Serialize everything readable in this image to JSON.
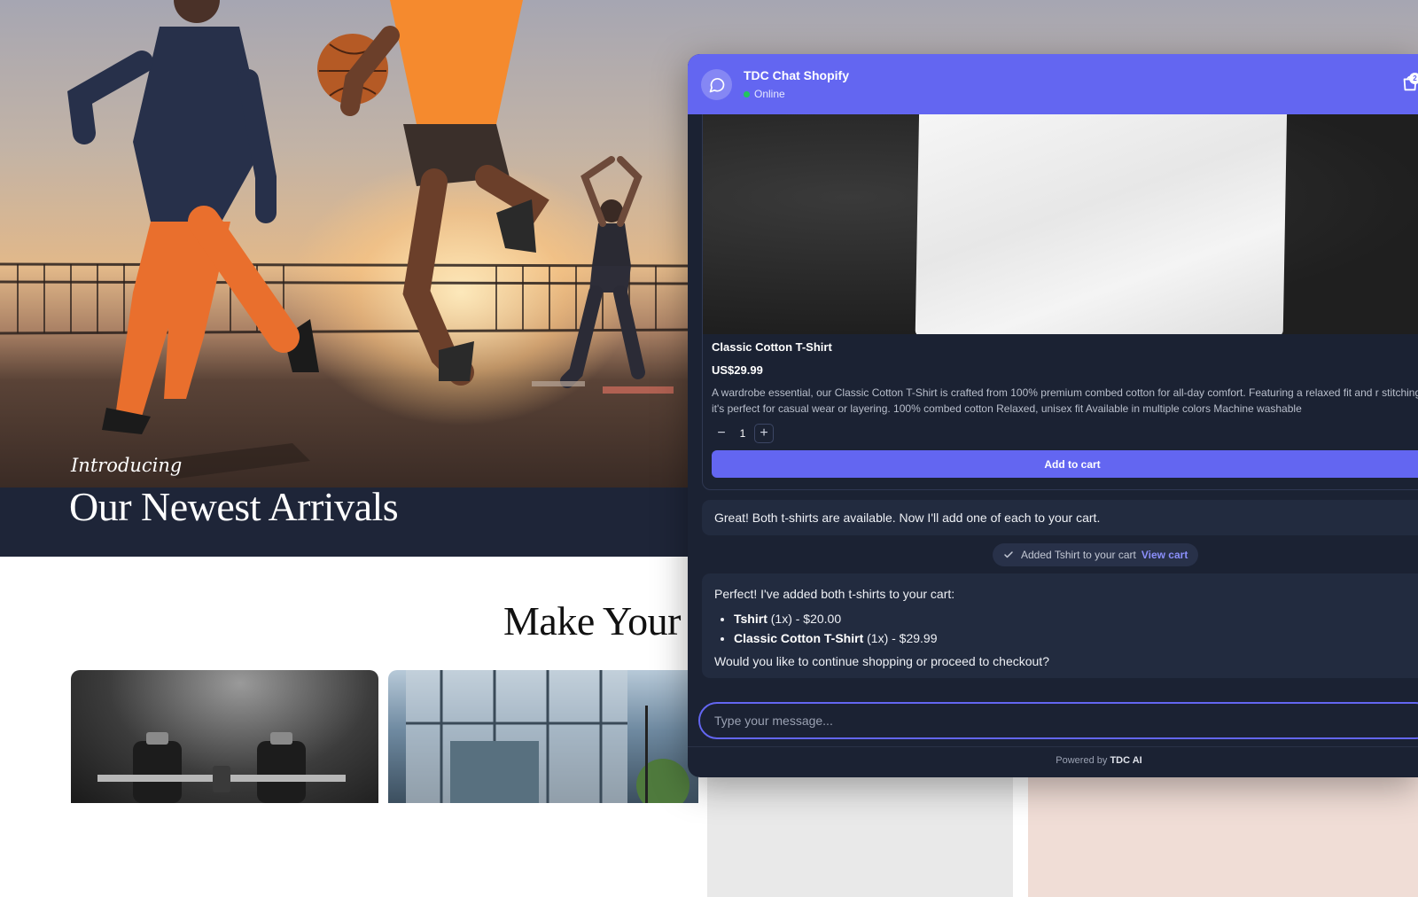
{
  "store": {
    "hero": {
      "introducing": "Introducing",
      "title": "Our Newest Arrivals"
    },
    "section_title": "Make Your W"
  },
  "chat": {
    "title": "TDC Chat Shopify",
    "status": "Online",
    "cart_count": "2",
    "product": {
      "name": "Classic Cotton T-Shirt",
      "price": "US$29.99",
      "description": "A wardrobe essential, our Classic Cotton T-Shirt is crafted from 100% premium combed cotton for all-day comfort. Featuring a relaxed fit and r stitching, it's perfect for casual wear or layering. 100% combed cotton Relaxed, unisex fit Available in multiple colors Machine washable",
      "quantity": "1",
      "minus_label": "−",
      "plus_label": "+",
      "add_to_cart_label": "Add to cart"
    },
    "messages": {
      "bot_1": "Great! Both t-shirts are available. Now I'll add one of each to your cart.",
      "system_notice": "Added Tshirt to your cart",
      "system_link": "View cart",
      "bot_2_intro": "Perfect! I've added both t-shirts to your cart:",
      "bot_2_items": [
        {
          "name": "Tshirt",
          "detail": " (1x) - $20.00"
        },
        {
          "name": "Classic Cotton T-Shirt",
          "detail": " (1x) - $29.99"
        }
      ],
      "bot_2_outro": "Would you like to continue shopping or proceed to checkout?"
    },
    "composer": {
      "placeholder": "Type your message..."
    },
    "footer": {
      "powered_by": "Powered by",
      "brand": "TDC AI"
    }
  },
  "colors": {
    "accent": "#6366f1",
    "chat_background": "#1b2233",
    "bubble_background": "#222b3f",
    "online": "#22c55e"
  },
  "icons": {
    "chat_avatar": "chat-bubble-icon",
    "cart": "shopping-bag-icon",
    "system_check": "check-icon"
  }
}
